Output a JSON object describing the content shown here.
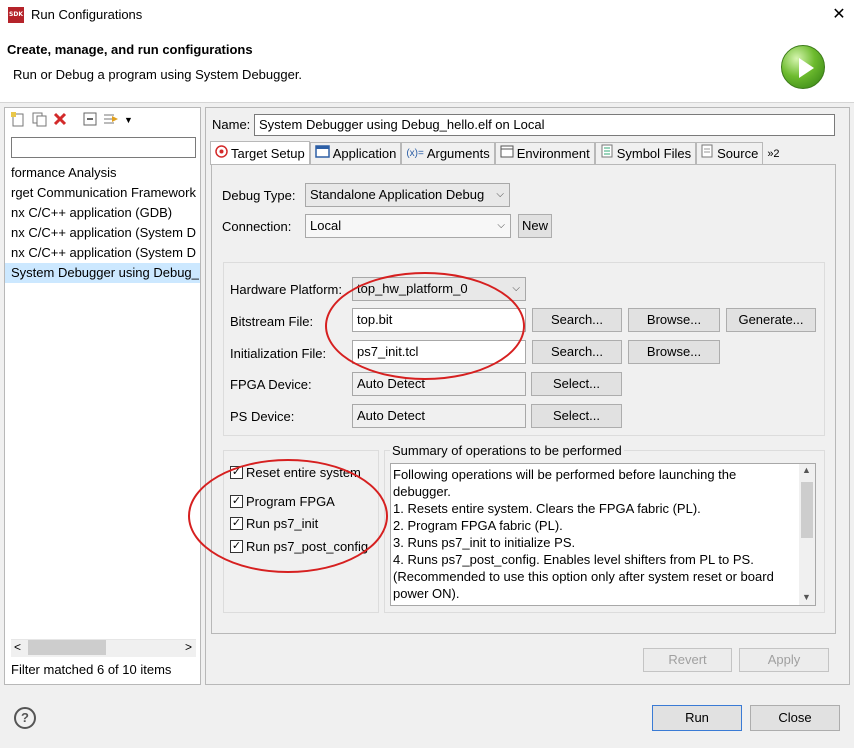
{
  "window": {
    "title": "Run Configurations",
    "close_glyph": "✕"
  },
  "app_icon_text": "SDK",
  "header": {
    "title": "Create, manage, and run configurations",
    "subtitle": "Run or Debug a program using System Debugger."
  },
  "left": {
    "filter_value": "",
    "items": [
      {
        "label": "formance Analysis"
      },
      {
        "label": "rget Communication Framework"
      },
      {
        "label": "nx C/C++ application (GDB)"
      },
      {
        "label": "nx C/C++ application (System D"
      },
      {
        "label": "nx C/C++ application (System D"
      },
      {
        "label": "System Debugger using Debug_"
      }
    ],
    "scroll_left": "<",
    "scroll_right": ">",
    "status": "Filter matched 6 of 10 items"
  },
  "name_label": "Name:",
  "name_value": "System Debugger using Debug_hello.elf on Local",
  "tabs": [
    {
      "label": "Target Setup"
    },
    {
      "label": "Application"
    },
    {
      "label": "Arguments"
    },
    {
      "label": "Environment"
    },
    {
      "label": "Symbol Files"
    },
    {
      "label": "Source"
    },
    {
      "label": "»2"
    }
  ],
  "form": {
    "debug_type_label": "Debug Type:",
    "debug_type_value": "Standalone Application Debug",
    "connection_label": "Connection:",
    "connection_value": "Local",
    "new_button": "New",
    "hw_platform_label": "Hardware Platform:",
    "hw_platform_value": "top_hw_platform_0",
    "bitstream_label": "Bitstream File:",
    "bitstream_value": "top.bit",
    "init_label": "Initialization File:",
    "init_value": "ps7_init.tcl",
    "fpga_label": "FPGA Device:",
    "fpga_value": "Auto Detect",
    "ps_label": "PS Device:",
    "ps_value": "Auto Detect",
    "search_button": "Search...",
    "browse_button": "Browse...",
    "generate_button": "Generate...",
    "select_button": "Select..."
  },
  "checks": [
    {
      "label": "Reset entire system",
      "checked": true
    },
    {
      "label": "Program FPGA",
      "checked": true
    },
    {
      "label": "Run ps7_init",
      "checked": true
    },
    {
      "label": "Run ps7_post_config",
      "checked": true
    }
  ],
  "check_glyph": "✓",
  "summary": {
    "title": "Summary of operations to be performed",
    "lines": [
      "Following operations will be performed before launching the",
      "debugger.",
      "1. Resets entire system. Clears the FPGA fabric (PL).",
      "2. Program FPGA fabric (PL).",
      "3. Runs ps7_init to initialize PS.",
      "4. Runs ps7_post_config. Enables level shifters from PL to PS.",
      "(Recommended to use this option only after system reset or board",
      "power ON)."
    ]
  },
  "revert_button": "Revert",
  "apply_button": "Apply",
  "run_button": "Run",
  "close_button": "Close",
  "help_glyph": "?",
  "colors": {
    "annotation": "#d62020",
    "selection": "#cce8ff"
  }
}
